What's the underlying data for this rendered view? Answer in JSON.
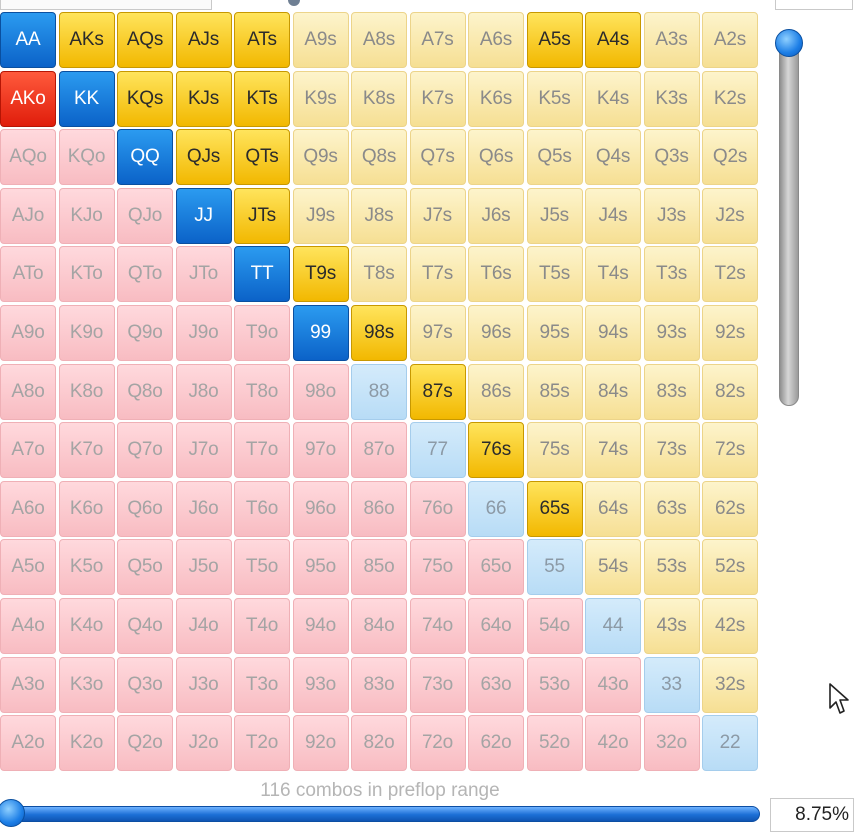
{
  "header": {
    "range_dropdown_value": "",
    "center_label": "",
    "weight_label": "",
    "weight_value": ""
  },
  "colors": {
    "suited_light": "#f9e7a6",
    "suited_selected": "#f7c500",
    "offsuit_light": "#fbc9ce",
    "offsuit_selected": "#f03418",
    "pair_light": "#c6e3f8",
    "pair_selected": "#1677de"
  },
  "grid": {
    "rows": [
      [
        {
          "l": "AA",
          "s": "bp"
        },
        {
          "l": "AKs",
          "s": "ds"
        },
        {
          "l": "AQs",
          "s": "ds"
        },
        {
          "l": "AJs",
          "s": "ds"
        },
        {
          "l": "ATs",
          "s": "ds"
        },
        {
          "l": "A9s",
          "s": "ls"
        },
        {
          "l": "A8s",
          "s": "ls"
        },
        {
          "l": "A7s",
          "s": "ls"
        },
        {
          "l": "A6s",
          "s": "ls"
        },
        {
          "l": "A5s",
          "s": "ds"
        },
        {
          "l": "A4s",
          "s": "ds"
        },
        {
          "l": "A3s",
          "s": "ls"
        },
        {
          "l": "A2s",
          "s": "ls"
        }
      ],
      [
        {
          "l": "AKo",
          "s": "ro"
        },
        {
          "l": "KK",
          "s": "bp"
        },
        {
          "l": "KQs",
          "s": "ds"
        },
        {
          "l": "KJs",
          "s": "ds"
        },
        {
          "l": "KTs",
          "s": "ds"
        },
        {
          "l": "K9s",
          "s": "ls"
        },
        {
          "l": "K8s",
          "s": "ls"
        },
        {
          "l": "K7s",
          "s": "ls"
        },
        {
          "l": "K6s",
          "s": "ls"
        },
        {
          "l": "K5s",
          "s": "ls"
        },
        {
          "l": "K4s",
          "s": "ls"
        },
        {
          "l": "K3s",
          "s": "ls"
        },
        {
          "l": "K2s",
          "s": "ls"
        }
      ],
      [
        {
          "l": "AQo",
          "s": "lo"
        },
        {
          "l": "KQo",
          "s": "lo"
        },
        {
          "l": "QQ",
          "s": "bp"
        },
        {
          "l": "QJs",
          "s": "ds"
        },
        {
          "l": "QTs",
          "s": "ds"
        },
        {
          "l": "Q9s",
          "s": "ls"
        },
        {
          "l": "Q8s",
          "s": "ls"
        },
        {
          "l": "Q7s",
          "s": "ls"
        },
        {
          "l": "Q6s",
          "s": "ls"
        },
        {
          "l": "Q5s",
          "s": "ls"
        },
        {
          "l": "Q4s",
          "s": "ls"
        },
        {
          "l": "Q3s",
          "s": "ls"
        },
        {
          "l": "Q2s",
          "s": "ls"
        }
      ],
      [
        {
          "l": "AJo",
          "s": "lo"
        },
        {
          "l": "KJo",
          "s": "lo"
        },
        {
          "l": "QJo",
          "s": "lo"
        },
        {
          "l": "JJ",
          "s": "bp"
        },
        {
          "l": "JTs",
          "s": "ds"
        },
        {
          "l": "J9s",
          "s": "ls"
        },
        {
          "l": "J8s",
          "s": "ls"
        },
        {
          "l": "J7s",
          "s": "ls"
        },
        {
          "l": "J6s",
          "s": "ls"
        },
        {
          "l": "J5s",
          "s": "ls"
        },
        {
          "l": "J4s",
          "s": "ls"
        },
        {
          "l": "J3s",
          "s": "ls"
        },
        {
          "l": "J2s",
          "s": "ls"
        }
      ],
      [
        {
          "l": "ATo",
          "s": "lo"
        },
        {
          "l": "KTo",
          "s": "lo"
        },
        {
          "l": "QTo",
          "s": "lo"
        },
        {
          "l": "JTo",
          "s": "lo"
        },
        {
          "l": "TT",
          "s": "bp"
        },
        {
          "l": "T9s",
          "s": "ds"
        },
        {
          "l": "T8s",
          "s": "ls"
        },
        {
          "l": "T7s",
          "s": "ls"
        },
        {
          "l": "T6s",
          "s": "ls"
        },
        {
          "l": "T5s",
          "s": "ls"
        },
        {
          "l": "T4s",
          "s": "ls"
        },
        {
          "l": "T3s",
          "s": "ls"
        },
        {
          "l": "T2s",
          "s": "ls"
        }
      ],
      [
        {
          "l": "A9o",
          "s": "lo"
        },
        {
          "l": "K9o",
          "s": "lo"
        },
        {
          "l": "Q9o",
          "s": "lo"
        },
        {
          "l": "J9o",
          "s": "lo"
        },
        {
          "l": "T9o",
          "s": "lo"
        },
        {
          "l": "99",
          "s": "bp"
        },
        {
          "l": "98s",
          "s": "ds"
        },
        {
          "l": "97s",
          "s": "ls"
        },
        {
          "l": "96s",
          "s": "ls"
        },
        {
          "l": "95s",
          "s": "ls"
        },
        {
          "l": "94s",
          "s": "ls"
        },
        {
          "l": "93s",
          "s": "ls"
        },
        {
          "l": "92s",
          "s": "ls"
        }
      ],
      [
        {
          "l": "A8o",
          "s": "lo"
        },
        {
          "l": "K8o",
          "s": "lo"
        },
        {
          "l": "Q8o",
          "s": "lo"
        },
        {
          "l": "J8o",
          "s": "lo"
        },
        {
          "l": "T8o",
          "s": "lo"
        },
        {
          "l": "98o",
          "s": "lo"
        },
        {
          "l": "88",
          "s": "lp"
        },
        {
          "l": "87s",
          "s": "ds"
        },
        {
          "l": "86s",
          "s": "ls"
        },
        {
          "l": "85s",
          "s": "ls"
        },
        {
          "l": "84s",
          "s": "ls"
        },
        {
          "l": "83s",
          "s": "ls"
        },
        {
          "l": "82s",
          "s": "ls"
        }
      ],
      [
        {
          "l": "A7o",
          "s": "lo"
        },
        {
          "l": "K7o",
          "s": "lo"
        },
        {
          "l": "Q7o",
          "s": "lo"
        },
        {
          "l": "J7o",
          "s": "lo"
        },
        {
          "l": "T7o",
          "s": "lo"
        },
        {
          "l": "97o",
          "s": "lo"
        },
        {
          "l": "87o",
          "s": "lo"
        },
        {
          "l": "77",
          "s": "lp"
        },
        {
          "l": "76s",
          "s": "ds"
        },
        {
          "l": "75s",
          "s": "ls"
        },
        {
          "l": "74s",
          "s": "ls"
        },
        {
          "l": "73s",
          "s": "ls"
        },
        {
          "l": "72s",
          "s": "ls"
        }
      ],
      [
        {
          "l": "A6o",
          "s": "lo"
        },
        {
          "l": "K6o",
          "s": "lo"
        },
        {
          "l": "Q6o",
          "s": "lo"
        },
        {
          "l": "J6o",
          "s": "lo"
        },
        {
          "l": "T6o",
          "s": "lo"
        },
        {
          "l": "96o",
          "s": "lo"
        },
        {
          "l": "86o",
          "s": "lo"
        },
        {
          "l": "76o",
          "s": "lo"
        },
        {
          "l": "66",
          "s": "lp"
        },
        {
          "l": "65s",
          "s": "ds"
        },
        {
          "l": "64s",
          "s": "ls"
        },
        {
          "l": "63s",
          "s": "ls"
        },
        {
          "l": "62s",
          "s": "ls"
        }
      ],
      [
        {
          "l": "A5o",
          "s": "lo"
        },
        {
          "l": "K5o",
          "s": "lo"
        },
        {
          "l": "Q5o",
          "s": "lo"
        },
        {
          "l": "J5o",
          "s": "lo"
        },
        {
          "l": "T5o",
          "s": "lo"
        },
        {
          "l": "95o",
          "s": "lo"
        },
        {
          "l": "85o",
          "s": "lo"
        },
        {
          "l": "75o",
          "s": "lo"
        },
        {
          "l": "65o",
          "s": "lo"
        },
        {
          "l": "55",
          "s": "lp"
        },
        {
          "l": "54s",
          "s": "ls"
        },
        {
          "l": "53s",
          "s": "ls"
        },
        {
          "l": "52s",
          "s": "ls"
        }
      ],
      [
        {
          "l": "A4o",
          "s": "lo"
        },
        {
          "l": "K4o",
          "s": "lo"
        },
        {
          "l": "Q4o",
          "s": "lo"
        },
        {
          "l": "J4o",
          "s": "lo"
        },
        {
          "l": "T4o",
          "s": "lo"
        },
        {
          "l": "94o",
          "s": "lo"
        },
        {
          "l": "84o",
          "s": "lo"
        },
        {
          "l": "74o",
          "s": "lo"
        },
        {
          "l": "64o",
          "s": "lo"
        },
        {
          "l": "54o",
          "s": "lo"
        },
        {
          "l": "44",
          "s": "lp"
        },
        {
          "l": "43s",
          "s": "ls"
        },
        {
          "l": "42s",
          "s": "ls"
        }
      ],
      [
        {
          "l": "A3o",
          "s": "lo"
        },
        {
          "l": "K3o",
          "s": "lo"
        },
        {
          "l": "Q3o",
          "s": "lo"
        },
        {
          "l": "J3o",
          "s": "lo"
        },
        {
          "l": "T3o",
          "s": "lo"
        },
        {
          "l": "93o",
          "s": "lo"
        },
        {
          "l": "83o",
          "s": "lo"
        },
        {
          "l": "73o",
          "s": "lo"
        },
        {
          "l": "63o",
          "s": "lo"
        },
        {
          "l": "53o",
          "s": "lo"
        },
        {
          "l": "43o",
          "s": "lo"
        },
        {
          "l": "33",
          "s": "lp"
        },
        {
          "l": "32s",
          "s": "ls"
        }
      ],
      [
        {
          "l": "A2o",
          "s": "lo"
        },
        {
          "l": "K2o",
          "s": "lo"
        },
        {
          "l": "Q2o",
          "s": "lo"
        },
        {
          "l": "J2o",
          "s": "lo"
        },
        {
          "l": "T2o",
          "s": "lo"
        },
        {
          "l": "92o",
          "s": "lo"
        },
        {
          "l": "82o",
          "s": "lo"
        },
        {
          "l": "72o",
          "s": "lo"
        },
        {
          "l": "62o",
          "s": "lo"
        },
        {
          "l": "52o",
          "s": "lo"
        },
        {
          "l": "42o",
          "s": "lo"
        },
        {
          "l": "32o",
          "s": "lo"
        },
        {
          "l": "22",
          "s": "lp"
        }
      ]
    ]
  },
  "footer": {
    "combos_label": "116 combos in preflop range",
    "percent_value": "8.75%",
    "range_slider_level": 0
  },
  "icons": {
    "cursor": "mouse-pointer-icon",
    "vertical_slider": "slider-knob",
    "horizontal_slider": "slider-knob"
  }
}
